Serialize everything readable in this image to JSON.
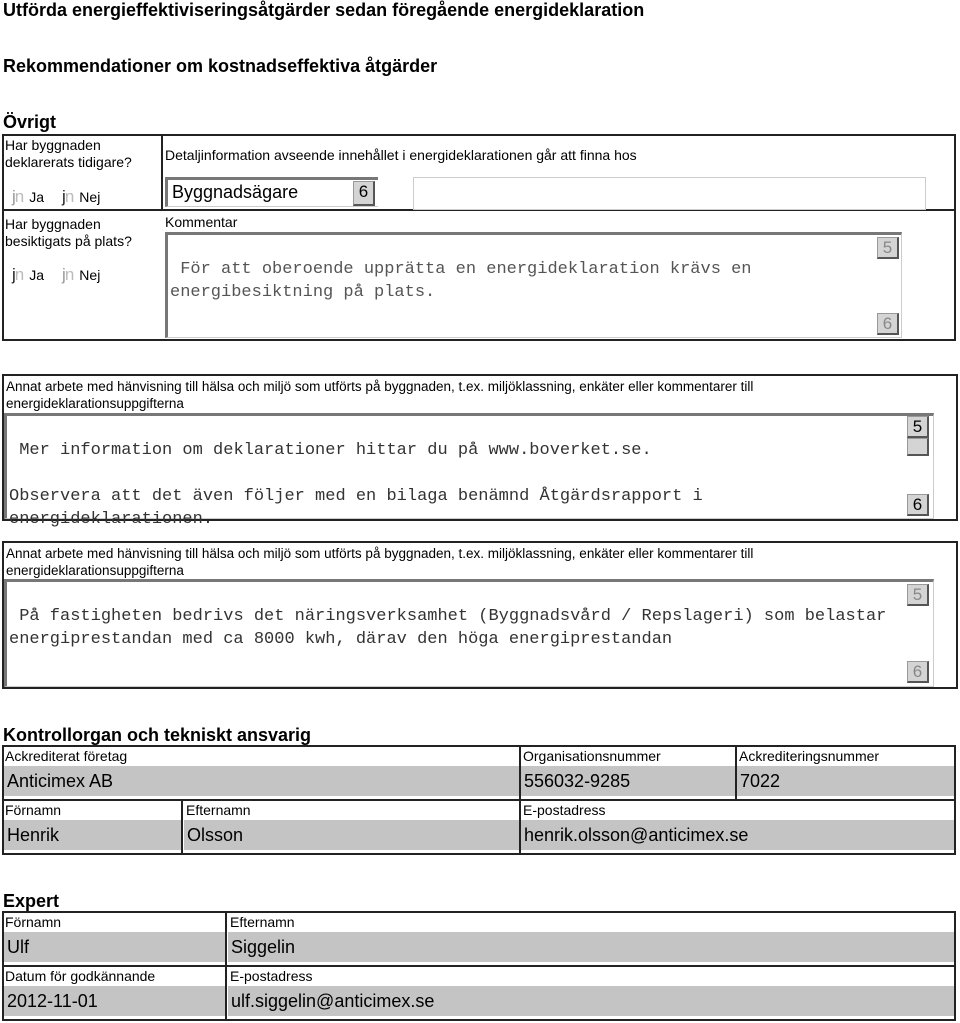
{
  "titles": {
    "t1": "Utförda energieffektiviseringsåtgärder sedan föregående energideklaration",
    "t2": "Rekommendationer om kostnadseffektiva åtgärder",
    "t3": "Övrigt"
  },
  "ovrigt": {
    "q1": "Har byggnaden deklarerats tidigare?",
    "q1_selected": "Nej",
    "q2": "Har byggnaden besiktigats på plats?",
    "q2_selected": "Ja",
    "ja": "Ja",
    "nej": "Nej",
    "detail_label": "Detaljinformation avseende innehållet i energideklarationen går att finna hos",
    "detail_select": "Byggnadsägare",
    "detail_other": "",
    "dropdown_glyph": "6",
    "scroll_up_glyph": "5",
    "scroll_down_glyph": "6",
    "kommentar_label": "Kommentar",
    "kommentar": "För att oberoende upprätta en energideklaration krävs en energibesiktning på plats."
  },
  "annat1": {
    "label": "Annat arbete med hänvisning till hälsa och miljö som utförts på byggnaden, t.ex. miljöklassning, enkäter eller kommentarer till energideklarationsuppgifterna",
    "text": "Mer information om deklarationer hittar du på www.boverket.se.\n\nObservera att det även följer med en bilaga benämnd Åtgärdsrapport i energideklarationen."
  },
  "annat2": {
    "label": "Annat arbete med hänvisning till hälsa och miljö som utförts på byggnaden, t.ex. miljöklassning, enkäter eller kommentarer till energideklarationsuppgifterna",
    "text": "På fastigheten bedrivs det näringsverksamhet (Byggnadsvård / Repslageri) som belastar energiprestandan med ca 8000 kwh, därav den höga energiprestandan"
  },
  "kontroll": {
    "title": "Kontrollorgan och tekniskt ansvarig",
    "foretag_label": "Ackrediterat företag",
    "foretag": "Anticimex AB",
    "orgnr_label": "Organisationsnummer",
    "orgnr": "556032-9285",
    "ackr_label": "Ackrediteringsnummer",
    "ackr": "7022",
    "fornamn_label": "Förnamn",
    "fornamn": "Henrik",
    "efternamn_label": "Efternamn",
    "efternamn": "Olsson",
    "epost_label": "E-postadress",
    "epost": "henrik.olsson@anticimex.se"
  },
  "expert": {
    "title": "Expert",
    "fornamn_label": "Förnamn",
    "fornamn": "Ulf",
    "efternamn_label": "Efternamn",
    "efternamn": "Siggelin",
    "datum_label": "Datum för godkännande",
    "datum": "2012-11-01",
    "epost_label": "E-postadress",
    "epost": "ulf.siggelin@anticimex.se"
  },
  "colors": {
    "field_bg": "#c4c4c4",
    "border": "#222222"
  }
}
